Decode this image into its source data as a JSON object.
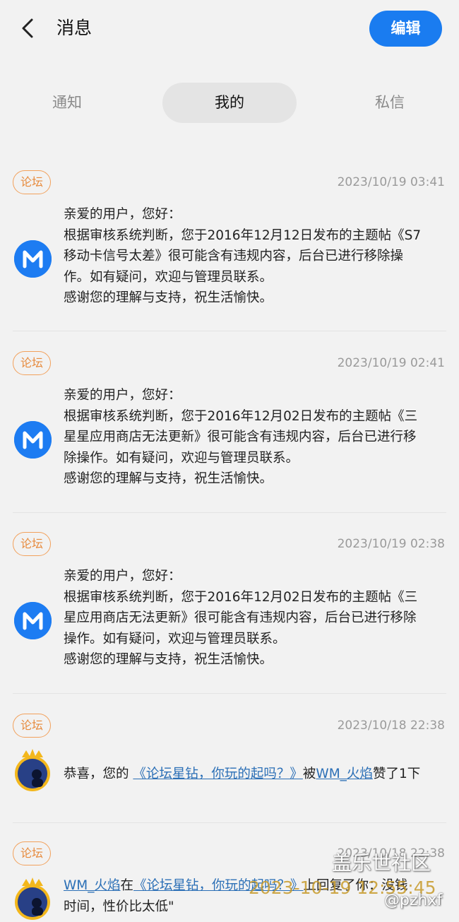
{
  "header": {
    "title": "消息",
    "edit_label": "编辑"
  },
  "tabs": [
    {
      "label": "通知",
      "active": false
    },
    {
      "label": "我的",
      "active": true
    },
    {
      "label": "私信",
      "active": false
    }
  ],
  "messages": [
    {
      "tag": "论坛",
      "time": "2023/10/19 03:41",
      "lines": [
        "亲爱的用户，您好：",
        "根据审核系统判断，您于2016年12月12日发布的主题帖《S7",
        "移动卡信号太差》很可能含有违规内容，后台已进行移除操",
        "作。如有疑问，欢迎与管理员联系。",
        "感谢您的理解与支持，祝生活愉快。"
      ]
    },
    {
      "tag": "论坛",
      "time": "2023/10/19 02:41",
      "lines": [
        "亲爱的用户，您好：",
        "根据审核系统判断，您于2016年12月02日发布的主题帖《三",
        "星星应用商店无法更新》很可能含有违规内容，后台已进行移",
        "除操作。如有疑问，欢迎与管理员联系。",
        "感谢您的理解与支持，祝生活愉快。"
      ]
    },
    {
      "tag": "论坛",
      "time": "2023/10/19 02:38",
      "lines": [
        "亲爱的用户，您好：",
        "根据审核系统判断，您于2016年12月02日发布的主题帖《三",
        "星应用商店无法更新》很可能含有违规内容，后台已进行移除",
        "操作。如有疑问，欢迎与管理员联系。",
        "感谢您的理解与支持，祝生活愉快。"
      ]
    },
    {
      "tag": "论坛",
      "time": "2023/10/18 22:38",
      "prefix": "恭喜，您的 ",
      "link_topic": "《论坛星钻，你玩的起吗？》",
      "mid": "被",
      "link_user": "WM_火焰",
      "suffix": "赞了1下"
    },
    {
      "tag": "论坛",
      "time": "2023/10/18 22:38",
      "link_user": "WM_火焰",
      "mid1": "在",
      "link_topic": "《论坛星钻，你玩的起吗？》",
      "mid2": "上回复了你：没钱",
      "line2": "时间，性价比太低\""
    }
  ],
  "watermarks": {
    "community": "盖乐世社区",
    "timestamp": "2023-10-19 12:55:45",
    "user": "@pzhxf"
  },
  "colors": {
    "accent": "#1a7cf0",
    "tag_orange": "#e78a3c",
    "link_blue": "#2b6fb6",
    "background": "#f2f2f2"
  }
}
